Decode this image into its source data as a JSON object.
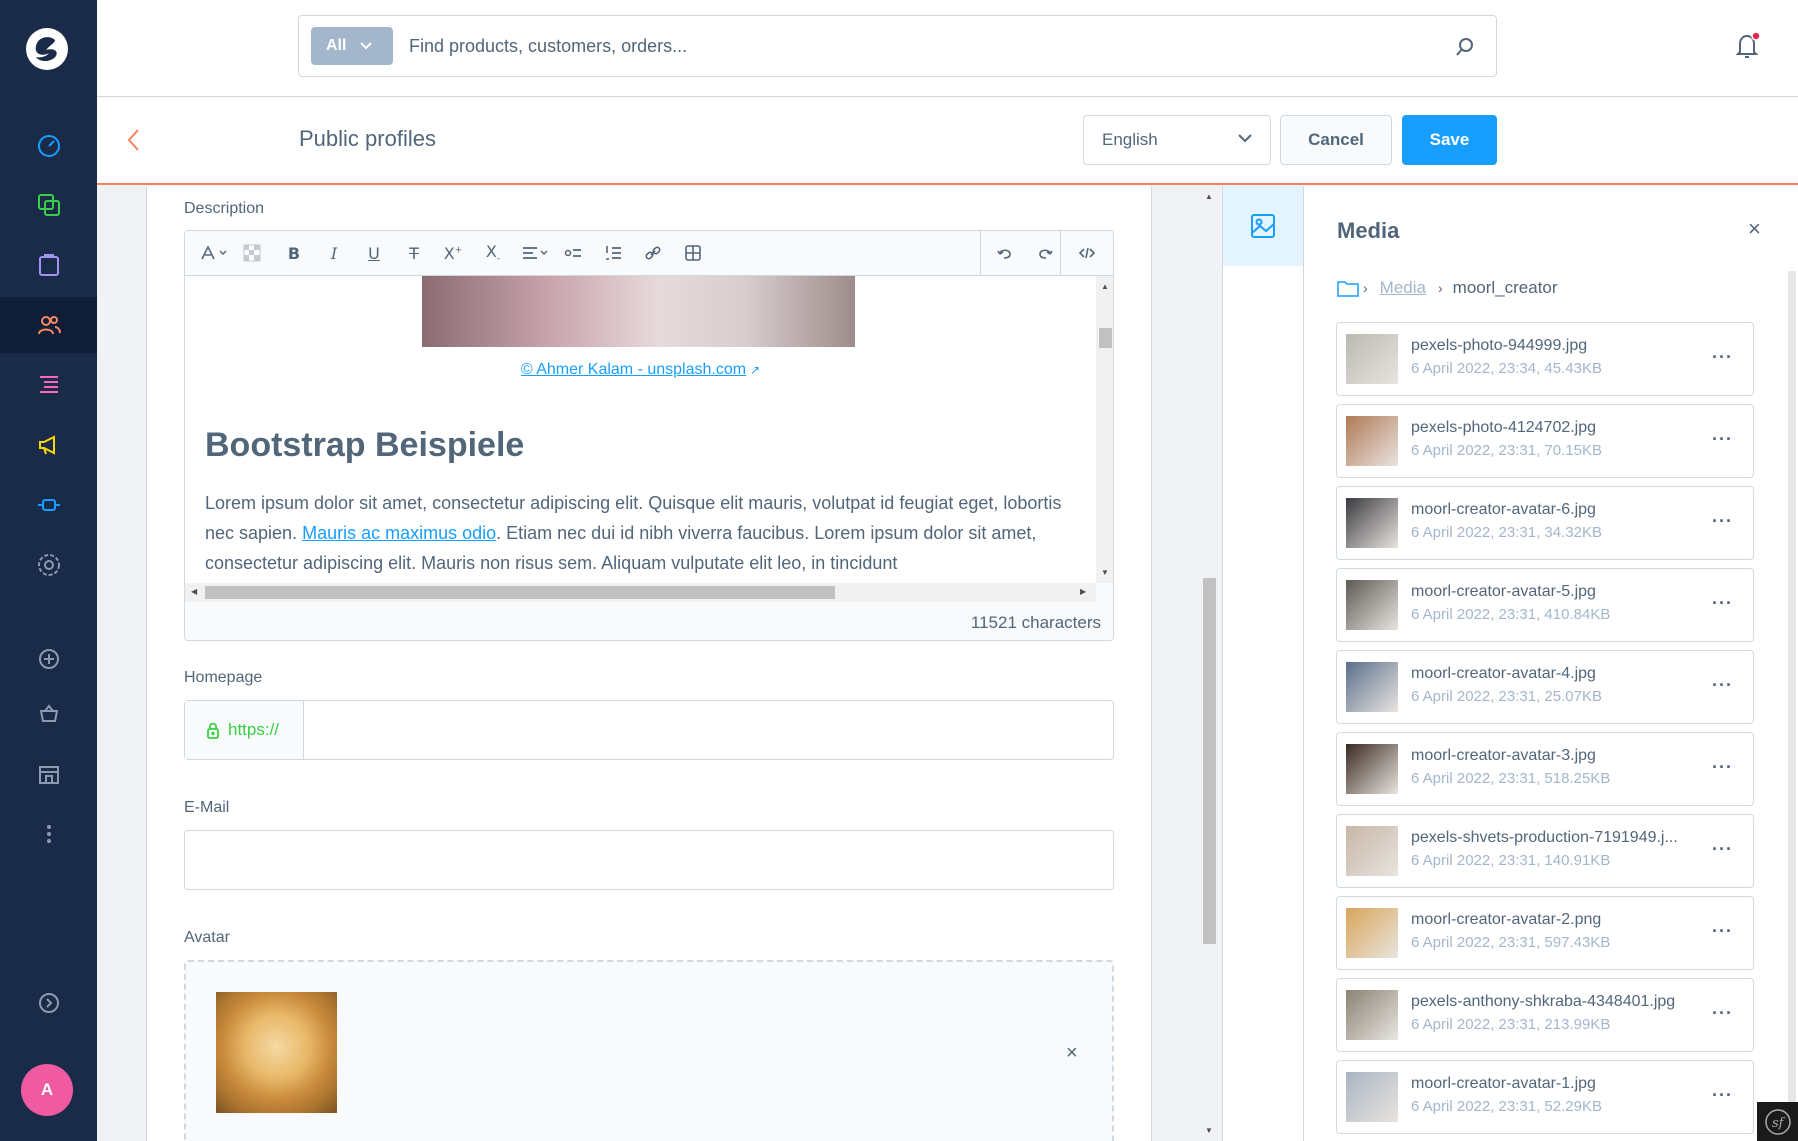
{
  "nav": {
    "avatar_initial": "A",
    "items": [
      {
        "name": "dashboard-icon"
      },
      {
        "name": "catalogue-icon"
      },
      {
        "name": "orders-icon"
      },
      {
        "name": "customers-icon"
      },
      {
        "name": "content-icon"
      },
      {
        "name": "marketing-icon"
      },
      {
        "name": "extensions-icon"
      },
      {
        "name": "settings-icon"
      },
      {
        "name": "add-icon"
      },
      {
        "name": "sales-channel-icon"
      },
      {
        "name": "storefront-icon"
      },
      {
        "name": "more-icon"
      },
      {
        "name": "expand-icon"
      }
    ]
  },
  "search": {
    "filter_label": "All",
    "placeholder": "Find products, customers, orders..."
  },
  "smartbar": {
    "title": "Public profiles",
    "language": "English",
    "cancel_label": "Cancel",
    "save_label": "Save"
  },
  "form": {
    "description_label": "Description",
    "credit_text": "© Ahmer Kalam - unsplash.com",
    "heading": "Bootstrap Beispiele",
    "para_1": "Lorem ipsum dolor sit amet, consectetur adipiscing elit. Quisque elit mauris, volutpat id feugiat eget, lobortis nec sapien. ",
    "para_link": "Mauris ac maximus odio",
    "para_2": ". Etiam nec dui id nibh viverra faucibus. Lorem ipsum dolor sit amet, consectetur adipiscing elit. Mauris non risus sem. Aliquam vulputate elit leo, in tincidunt",
    "char_count": "11521 characters",
    "homepage_label": "Homepage",
    "homepage_prefix": "https://",
    "email_label": "E-Mail",
    "avatar_label": "Avatar",
    "avatar_remove": "×"
  },
  "media": {
    "title": "Media",
    "close": "×",
    "breadcrumb_root": "Media",
    "breadcrumb_current": "moorl_creator",
    "items": [
      {
        "name": "pexels-photo-944999.jpg",
        "meta": "6 April 2022, 23:34, 45.43KB",
        "thumb": "#b9b9b1"
      },
      {
        "name": "pexels-photo-4124702.jpg",
        "meta": "6 April 2022, 23:31, 70.15KB",
        "thumb": "#b07a55"
      },
      {
        "name": "moorl-creator-avatar-6.jpg",
        "meta": "6 April 2022, 23:31, 34.32KB",
        "thumb": "#3c3b40"
      },
      {
        "name": "moorl-creator-avatar-5.jpg",
        "meta": "6 April 2022, 23:31, 410.84KB",
        "thumb": "#5e5a55"
      },
      {
        "name": "moorl-creator-avatar-4.jpg",
        "meta": "6 April 2022, 23:31, 25.07KB",
        "thumb": "#5b6f8c"
      },
      {
        "name": "moorl-creator-avatar-3.jpg",
        "meta": "6 April 2022, 23:31, 518.25KB",
        "thumb": "#3b2a22"
      },
      {
        "name": "pexels-shvets-production-7191949.j...",
        "meta": "6 April 2022, 23:31, 140.91KB",
        "thumb": "#c7b6a6"
      },
      {
        "name": "moorl-creator-avatar-2.png",
        "meta": "6 April 2022, 23:31, 597.43KB",
        "thumb": "#d9a55a"
      },
      {
        "name": "pexels-anthony-shkraba-4348401.jpg",
        "meta": "6 April 2022, 23:31, 213.99KB",
        "thumb": "#8a8275"
      },
      {
        "name": "moorl-creator-avatar-1.jpg",
        "meta": "6 April 2022, 23:31, 52.29KB",
        "thumb": "#a9b4c2"
      }
    ]
  },
  "colors": {
    "nav_bg": "#1a2b4a",
    "accent": "#189eff",
    "smartbar_border": "#f2835a",
    "https_green": "#37d046"
  }
}
